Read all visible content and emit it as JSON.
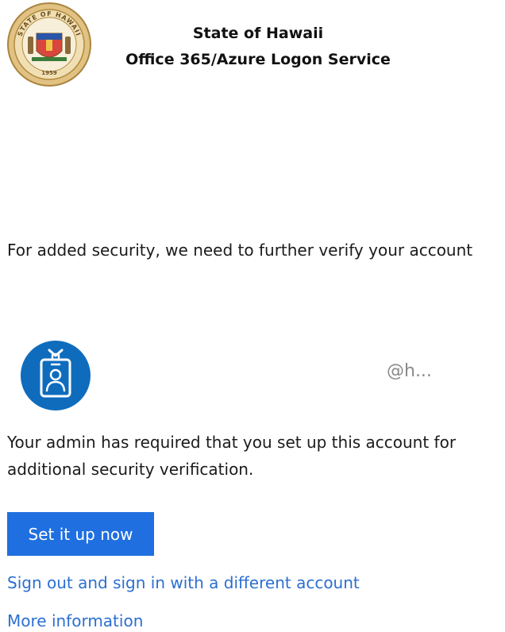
{
  "header": {
    "seal_text": "STATE OF HAWAII",
    "seal_year": "1959",
    "title_line1": "State of Hawaii",
    "title_line2": "Office 365/Azure Logon Service"
  },
  "main": {
    "headline": "For added security, we need to further verify your account",
    "account_id": "@h...",
    "description": "Your admin has required that you set up this account for additional security verification.",
    "setup_button_label": "Set it up now",
    "signout_link_label": "Sign out and sign in with a different account",
    "more_info_link_label": "More information"
  },
  "colors": {
    "primary_button": "#1f6fe0",
    "link": "#2c6fd1",
    "user_icon_circle": "#0f6cbd",
    "seal_gold": "#c9a04e"
  },
  "icons": {
    "seal": "state-seal-icon",
    "user": "user-badge-icon"
  }
}
